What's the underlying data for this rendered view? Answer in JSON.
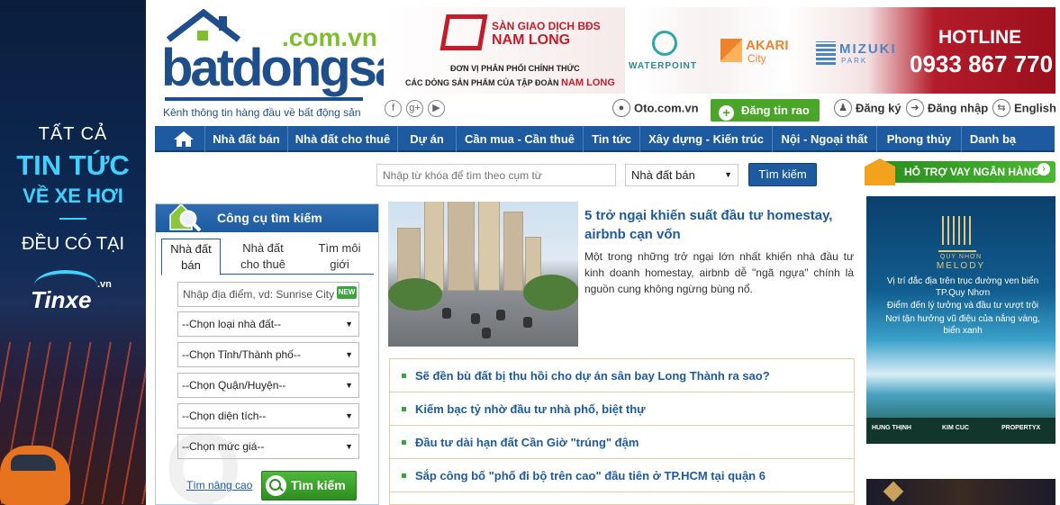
{
  "left_ad": {
    "line1": "TẤT CẢ",
    "line2": "TIN TỨC",
    "line3": "VỀ XE HƠI",
    "line4": "ĐỀU CÓ TẠI",
    "brand": "Tinxe",
    "brand_suffix": ".vn"
  },
  "logo": {
    "domain": ".com.vn",
    "name": "batdongsan",
    "tagline": "Kênh thông tin hàng đầu về bất động sản"
  },
  "banner": {
    "company_line1": "SÀN GIAO DỊCH BĐS",
    "company_line2": "NAM LONG",
    "sub1": "ĐƠN VỊ PHÂN PHỐI CHÍNH THỨC",
    "sub2": "CÁC DÒNG SẢN PHẨM CỦA TẬP ĐOÀN",
    "sub2_brand": "NAM LONG",
    "project1": "WATERPOINT",
    "project2_a": "AKARI",
    "project2_b": "City",
    "project3_a": "MIZUKI",
    "project3_b": "PARK",
    "hotline_label": "HOTLINE",
    "hotline": "0933 867 770"
  },
  "social": {
    "facebook": "f",
    "google": "g+",
    "youtube": "▶"
  },
  "top_links": {
    "oto": "Oto.com.vn",
    "post": "Đăng tin rao",
    "register": "Đăng ký",
    "login": "Đăng nhập",
    "language": "English"
  },
  "nav": {
    "items": [
      "Nhà đất bán",
      "Nhà đất cho thuê",
      "Dự án",
      "Cần mua - Cần thuê",
      "Tin tức",
      "Xây dựng - Kiến trúc",
      "Nội - Ngoại thất",
      "Phong thủy",
      "Danh bạ"
    ]
  },
  "search_bar": {
    "placeholder": "Nhập từ khóa để tìm theo cụm từ",
    "type_selected": "Nhà đất bán",
    "button": "Tìm kiếm"
  },
  "loan_banner": "HỖ TRỢ VAY NGÂN HÀNG",
  "search_panel": {
    "title": "Công cụ tìm kiếm",
    "tabs": [
      {
        "line1": "Nhà đất",
        "line2": "bán"
      },
      {
        "line1": "Nhà đất",
        "line2": "cho thuê"
      },
      {
        "line1": "Tìm môi",
        "line2": "giới"
      }
    ],
    "location_placeholder": "Nhập địa điểm, vd: Sunrise City",
    "new_badge": "NEW",
    "selects": [
      "--Chọn loại nhà đất--",
      "--Chọn Tỉnh/Thành phố--",
      "--Chọn Quận/Huyện--",
      "--Chọn diện tích--",
      "--Chọn mức giá--"
    ],
    "advanced": "Tìm nâng cao",
    "button": "Tìm kiếm"
  },
  "featured": {
    "title": "5 trở ngại khiến suất đầu tư homestay, airbnb cạn vốn",
    "desc": "Một trong những trở ngại lớn nhất khiến nhà đầu tư kinh doanh homestay, airbnb dễ \"ngã ngựa\" chính là nguồn cung không ngừng bùng nổ."
  },
  "news": [
    "Sẽ đền bù đất bị thu hồi cho dự án sân bay Long Thành ra sao?",
    "Kiếm bạc tỷ nhờ đầu tư nhà phố, biệt thự",
    "Đầu tư dài hạn đất Cần Giờ \"trúng\" đậm",
    "Sắp công bố \"phố đi bộ trên cao\" đầu tiên ở TP.HCM tại quận 6"
  ],
  "right_ad": {
    "brand_small": "QUY NHƠN",
    "brand": "MELODY",
    "bullets": [
      "Vị trí đắc địa trên trục đường ven biển TP.Quy Nhơn",
      "Điểm đến lý tưởng và đầu tư vượt trội",
      "Nơi tận hưởng vũ điệu của nắng vàng, biển xanh"
    ],
    "dev1": "HUNG THỊNH",
    "dev2": "KIM CUC",
    "dev3": "PROPERTYX"
  },
  "colors": {
    "brand_blue": "#1d5aa0",
    "brand_green": "#4aa629",
    "accent_red": "#c31d2b"
  }
}
